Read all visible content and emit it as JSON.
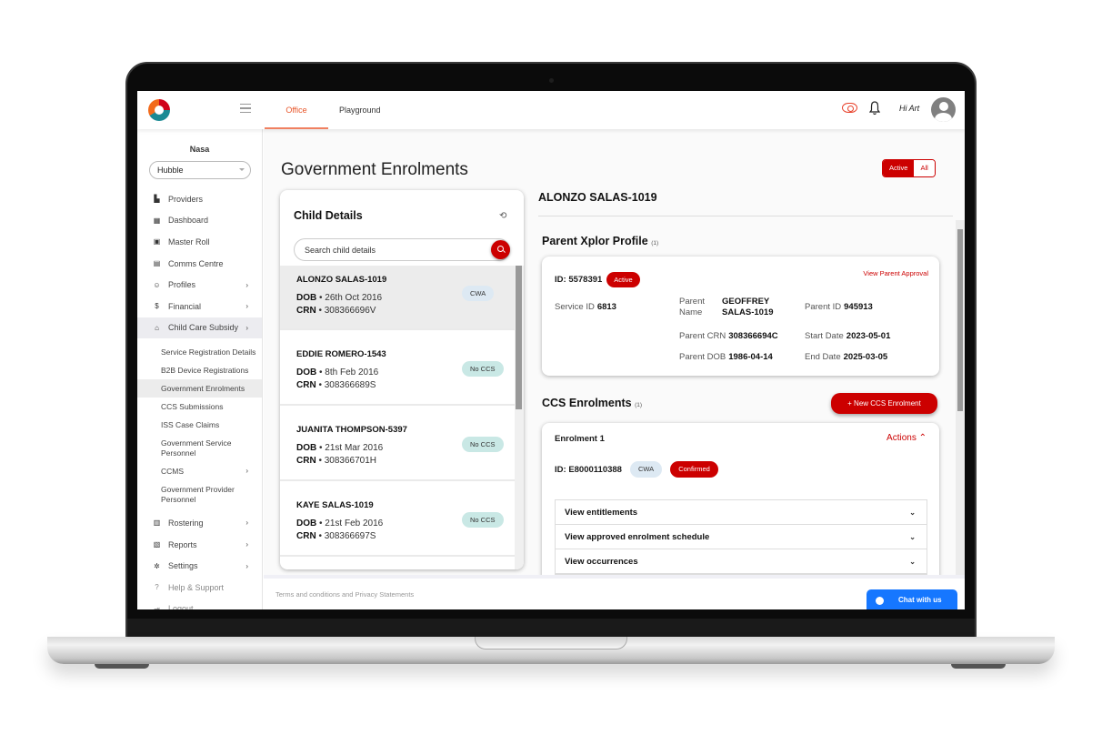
{
  "topbar": {
    "tabs": [
      {
        "label": "Office",
        "active": true
      },
      {
        "label": "Playground",
        "active": false
      }
    ],
    "greeting": "Hi Art",
    "icons": [
      "logo",
      "hamburger-icon",
      "eye-icon",
      "bell-icon",
      "avatar-icon"
    ]
  },
  "sidebar": {
    "org_name": "Nasa",
    "selected_service": "Hubble",
    "items": [
      {
        "label": "Providers",
        "icon": "building-icon"
      },
      {
        "label": "Dashboard",
        "icon": "dashboard-icon"
      },
      {
        "label": "Master Roll",
        "icon": "calendar-icon"
      },
      {
        "label": "Comms Centre",
        "icon": "chat-icon"
      },
      {
        "label": "Profiles",
        "icon": "profile-icon",
        "chevron": true
      },
      {
        "label": "Financial",
        "icon": "dollar-icon",
        "chevron": true
      },
      {
        "label": "Child Care Subsidy",
        "icon": "bank-icon",
        "chevron": true,
        "active": true
      }
    ],
    "sub_items": [
      {
        "label": "Service Registration Details"
      },
      {
        "label": "B2B Device Registrations"
      },
      {
        "label": "Government Enrolments",
        "active": true
      },
      {
        "label": "CCS Submissions"
      },
      {
        "label": "ISS Case Claims"
      },
      {
        "label": "Government Service Personnel"
      },
      {
        "label": "CCMS",
        "chevron": true
      },
      {
        "label": "Government Provider Personnel"
      }
    ],
    "bottom_items": [
      {
        "label": "Rostering",
        "icon": "roster-icon",
        "chevron": true
      },
      {
        "label": "Reports",
        "icon": "report-icon",
        "chevron": true
      },
      {
        "label": "Settings",
        "icon": "gear-icon",
        "chevron": true
      },
      {
        "label": "Help & Support",
        "icon": "help-icon"
      },
      {
        "label": "Logout",
        "icon": "logout-icon"
      }
    ]
  },
  "main": {
    "title": "Government Enrolments",
    "filter": {
      "active_label": "Active",
      "all_label": "All",
      "selected": "Active"
    },
    "child_details": {
      "title": "Child Details",
      "search_placeholder": "Search child details",
      "children": [
        {
          "name": "ALONZO SALAS-1019",
          "dob_label": "DOB",
          "dob": "26th Oct 2016",
          "crn_label": "CRN",
          "crn": "308366696V",
          "status": "CWA",
          "selected": true
        },
        {
          "name": "EDDIE ROMERO-1543",
          "dob_label": "DOB",
          "dob": "8th Feb 2016",
          "crn_label": "CRN",
          "crn": "308366689S",
          "status": "No CCS"
        },
        {
          "name": "JUANITA THOMPSON-5397",
          "dob_label": "DOB",
          "dob": "21st Mar 2016",
          "crn_label": "CRN",
          "crn": "308366701H",
          "status": "No CCS"
        },
        {
          "name": "KAYE SALAS-1019",
          "dob_label": "DOB",
          "dob": "21st Feb 2016",
          "crn_label": "CRN",
          "crn": "308366697S",
          "status": "No CCS"
        }
      ]
    },
    "detail": {
      "child_name": "ALONZO SALAS-1019",
      "parent_section": {
        "title": "Parent Xplor Profile",
        "count": "(1)",
        "id_label": "ID:",
        "id": "5578391",
        "status": "Active",
        "view_approval": "View Parent Approval",
        "service_id_label": "Service ID",
        "service_id": "6813",
        "parent_name_label": "Parent Name",
        "parent_name": "GEOFFREY SALAS-1019",
        "parent_id_label": "Parent ID",
        "parent_id": "945913",
        "parent_crn_label": "Parent CRN",
        "parent_crn": "308366694C",
        "start_date_label": "Start Date",
        "start_date": "2023-05-01",
        "parent_dob_label": "Parent DOB",
        "parent_dob": "1986-04-14",
        "end_date_label": "End Date",
        "end_date": "2025-03-05"
      },
      "ccs_section": {
        "title": "CCS Enrolments",
        "count": "(1)",
        "new_button": "+ New CCS Enrolment",
        "enrolment": {
          "title": "Enrolment 1",
          "actions_label": "Actions",
          "id_label": "ID:",
          "id": "E8000110388",
          "type": "CWA",
          "status": "Confirmed",
          "accordions": [
            {
              "label": "View entitlements"
            },
            {
              "label": "View approved enrolment schedule"
            },
            {
              "label": "View occurrences"
            }
          ]
        }
      }
    }
  },
  "footer": {
    "terms": "Terms and conditions and Privacy Statements",
    "chat": "Chat with us"
  },
  "colors": {
    "brand_red": "#cc0000",
    "accent_orange": "#e8562a",
    "chat_blue": "#1677ff",
    "pill_cwa": "#dde9f3",
    "pill_noccs": "#c9e8e5"
  }
}
